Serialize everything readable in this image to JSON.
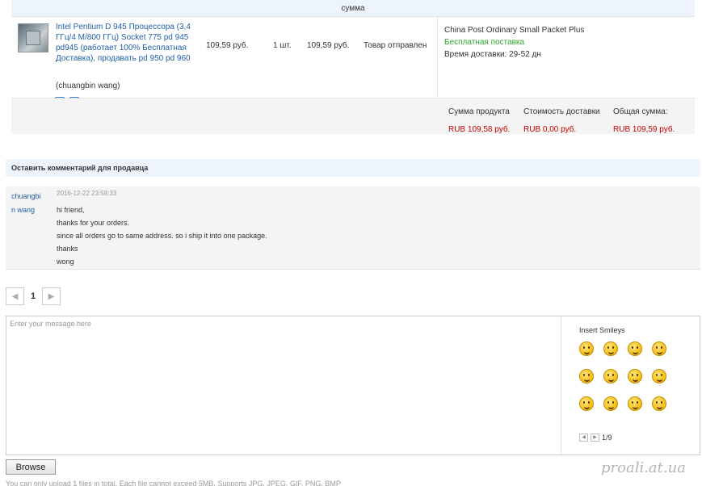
{
  "order": {
    "header": "сумма",
    "product": {
      "title": "Intel Pentium D 945 Процессора (3,4 ГГц/4 M/800 ГГц) Socket 775 pd 945 pd945 (работает 100% Бесплатная Доставка), продавать pd 950 pd 960",
      "seller": "(chuangbin wang)",
      "price": "109,59 руб.",
      "quantity": "1 шт.",
      "total": "109,59 руб.",
      "status": "Товар отправлен"
    },
    "shipping": {
      "method": "China Post Ordinary Small Packet Plus",
      "free": "Бесплатная поставка",
      "delivery": "Время доставки: 29-52 дн"
    },
    "summary": {
      "product_label": "Сумма продукта",
      "product_value": "RUB 109,58 руб.",
      "shipping_label": "Стоимость доставки",
      "shipping_value": "RUB 0,00 руб.",
      "total_label": "Общая сумма:",
      "total_value": "RUB 109,59 руб."
    }
  },
  "comments": {
    "title": "Оставить комментарий для продавца",
    "items": [
      {
        "author_line1": "chuangbi",
        "author_line2": "n wang",
        "date": "2016-12-22 23:58:33",
        "lines": [
          "hi friend,",
          "thanks for your orders.",
          "since all orders go to same address. so i ship it into one package.",
          "thanks",
          "wong"
        ]
      }
    ]
  },
  "pager": {
    "current": "1"
  },
  "message": {
    "placeholder": "Enter your message here",
    "smileys_title": "Insert Smileys",
    "smileys_page": "1/9",
    "smileys": [
      "smile-icon",
      "wink-icon",
      "tongue-icon",
      "grin-icon",
      "laugh-icon",
      "shout-icon",
      "lol-icon",
      "blush-icon",
      "cry-icon",
      "dizzy-icon",
      "smirk-icon",
      "chuckle-icon"
    ]
  },
  "upload": {
    "browse_label": "Browse",
    "note": "You can only upload 1 files in total. Each file cannot exceed 5MB. Supports JPG, JPEG, GIF, PNG, BMP"
  },
  "watermark": "proali.at.ua"
}
